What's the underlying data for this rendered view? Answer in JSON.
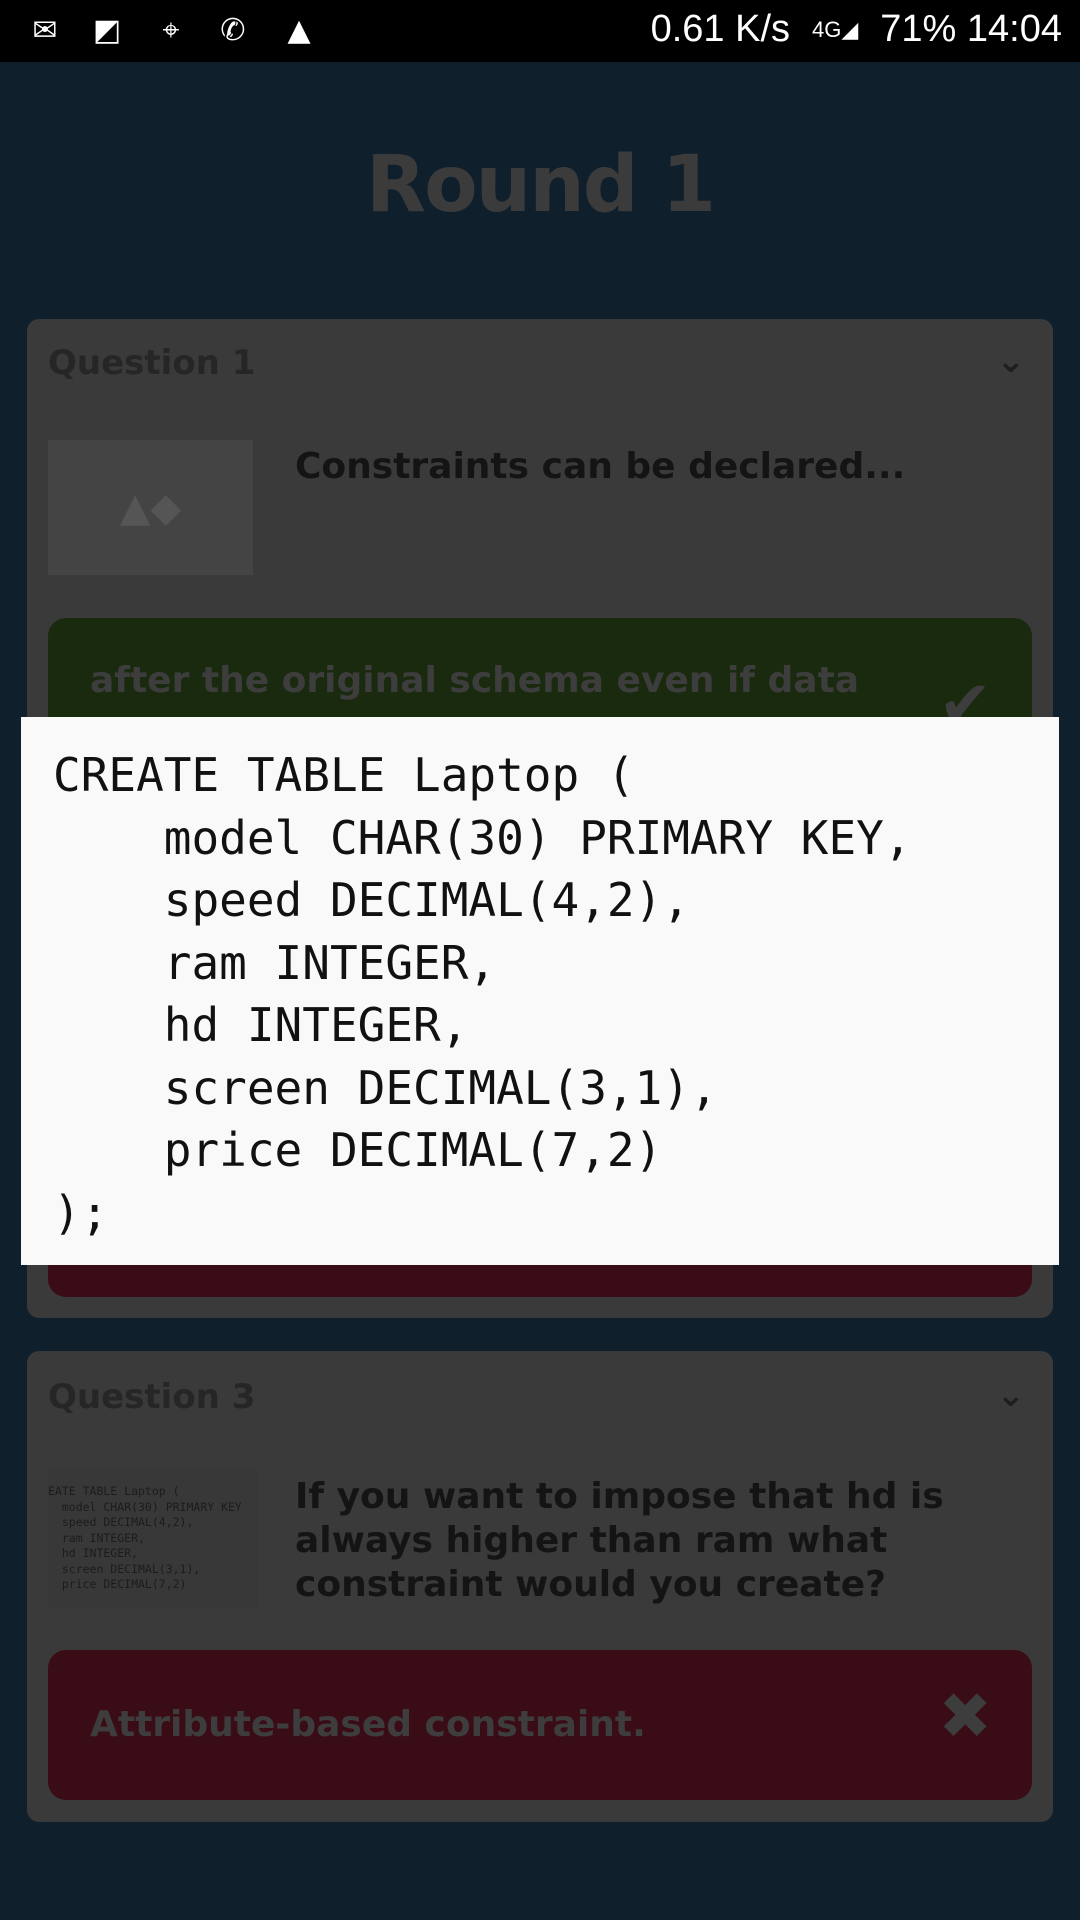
{
  "status_bar": {
    "icons": [
      "gmail-icon",
      "notes-icon",
      "maps-icon",
      "whatsapp-icon",
      "gallery-icon"
    ],
    "net_speed": "0.61 K/s",
    "network": "4G",
    "battery": "71%",
    "time": "14:04"
  },
  "page_title": "Round 1",
  "questions": [
    {
      "title": "Question 1",
      "text": "Constraints can be declared...",
      "answer": "after the original schema even if data",
      "answer_status": "correct",
      "answer_color": "#1a2a0e"
    },
    {
      "title": "Question 3",
      "text": "If you want to impose that hd is always higher than ram what constraint would you create?",
      "answer": "Attribute-based constraint.",
      "answer_status": "incorrect",
      "answer_color": "#3a0c16"
    }
  ],
  "code_popup": {
    "code": "CREATE TABLE Laptop (\n    model CHAR(30) PRIMARY KEY,\n    speed DECIMAL(4,2),\n    ram INTEGER,\n    hd INTEGER,\n    screen DECIMAL(3,1),\n    price DECIMAL(7,2)\n);"
  },
  "thumb_code": "EATE TABLE Laptop (\n  model CHAR(30) PRIMARY KEY\n  speed DECIMAL(4,2),\n  ram INTEGER,\n  hd INTEGER,\n  screen DECIMAL(3,1),\n  price DECIMAL(7,2)"
}
